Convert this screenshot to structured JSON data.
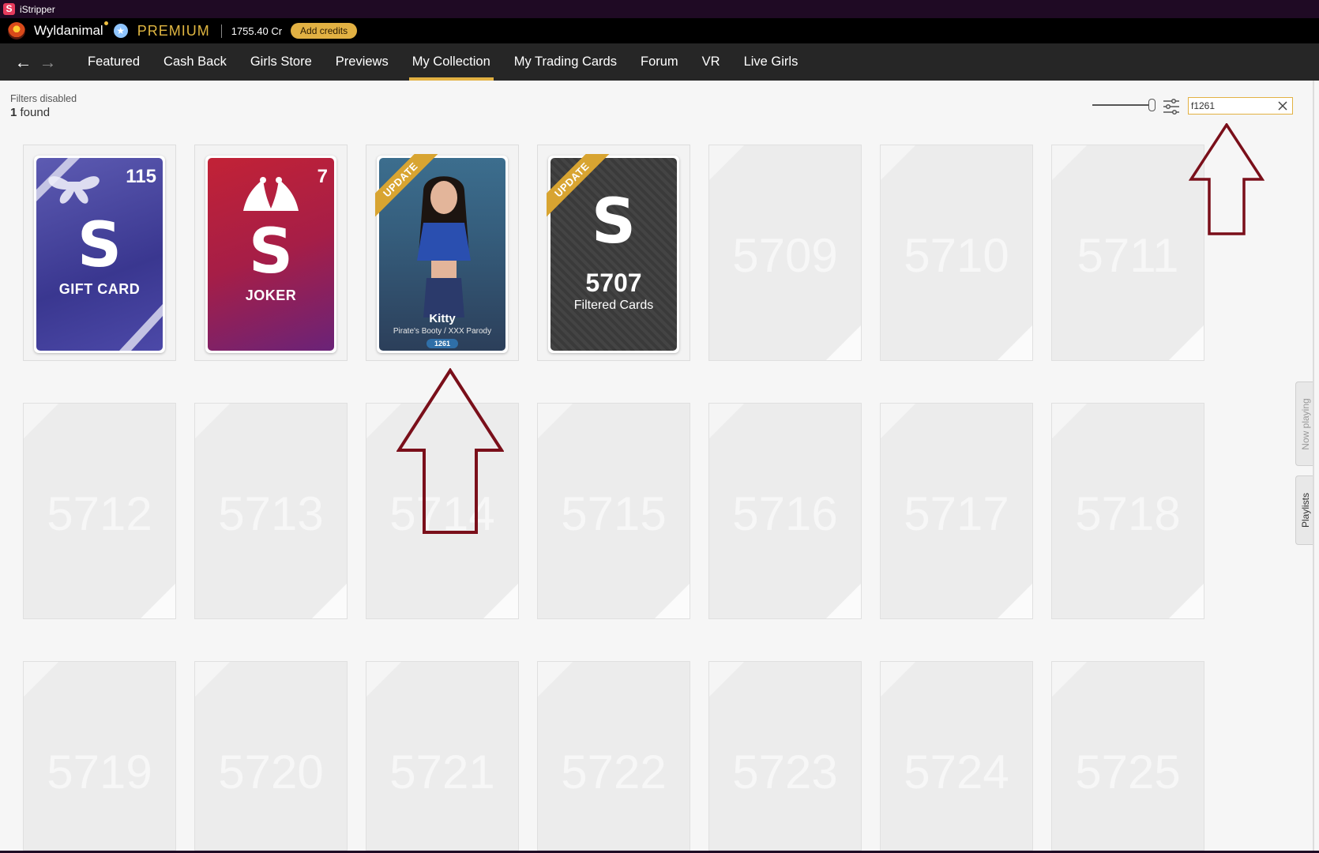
{
  "window": {
    "title": "iStripper",
    "logo_letter": "S"
  },
  "user": {
    "name": "Wyldanimal",
    "badge": "★",
    "tier": "PREMIUM",
    "credits": "1755.40 Cr",
    "add_credits_label": "Add credits"
  },
  "nav": {
    "back_glyph": "←",
    "forward_glyph": "→",
    "tabs": [
      {
        "label": "Featured"
      },
      {
        "label": "Cash Back"
      },
      {
        "label": "Girls Store"
      },
      {
        "label": "Previews"
      },
      {
        "label": "My Collection",
        "active": true
      },
      {
        "label": "My Trading Cards"
      },
      {
        "label": "Forum"
      },
      {
        "label": "VR"
      },
      {
        "label": "Live Girls"
      }
    ],
    "accent_color": "#e2b143"
  },
  "status": {
    "filters_label": "Filters disabled",
    "found_count": "1",
    "found_suffix": " found"
  },
  "toolbar": {
    "search_value": "f1261",
    "zoom_level": 1.0
  },
  "cards": {
    "gift": {
      "count": "115",
      "logo": "S",
      "caption": "GIFT CARD"
    },
    "joker": {
      "count": "7",
      "logo": "S",
      "caption": "JOKER"
    },
    "kitty": {
      "ribbon": "UPDATE",
      "name": "Kitty",
      "subtitle": "Pirate's Booty / XXX Parody",
      "id": "1261"
    },
    "filtered": {
      "ribbon": "UPDATE",
      "logo": "S",
      "count": "5707",
      "label": "Filtered Cards"
    }
  },
  "placeholder_slots": [
    "5709",
    "5710",
    "5711",
    "5712",
    "5713",
    "5714",
    "5715",
    "5716",
    "5717",
    "5718",
    "5719",
    "5720",
    "5721",
    "5722",
    "5723",
    "5724",
    "5725"
  ],
  "side_tabs": {
    "now_playing": "Now playing",
    "playlists": "Playlists"
  },
  "colors": {
    "titlebar": "#1f0a24",
    "navbar": "#262626",
    "premium": "#e0b641",
    "annotation_arrow": "#7a0f1a"
  }
}
